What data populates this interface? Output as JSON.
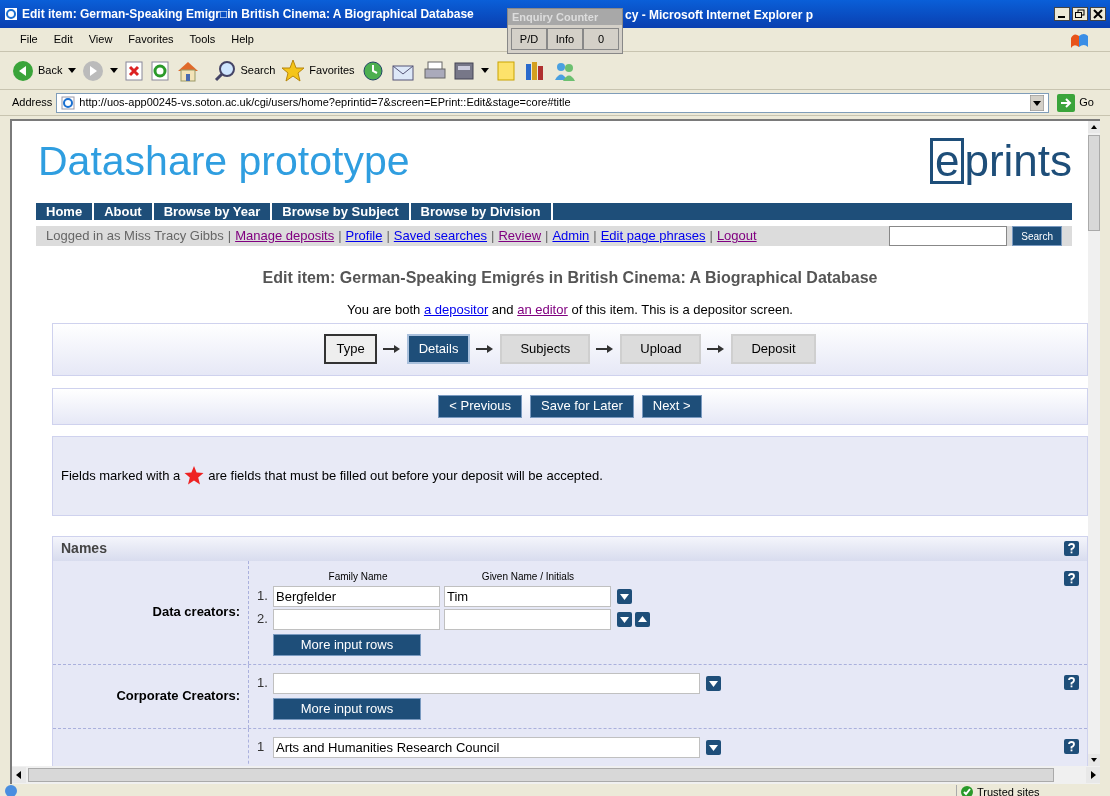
{
  "window": {
    "title_left": "Edit item: German-Speaking Emigr□in British Cinema: A Biographical Database",
    "title_right": "cy - Microsoft Internet Explorer p"
  },
  "enquiry_counter": {
    "title": "Enquiry Counter",
    "buttons": [
      "P/D",
      "Info",
      "0"
    ]
  },
  "menu": [
    "File",
    "Edit",
    "View",
    "Favorites",
    "Tools",
    "Help"
  ],
  "toolbar": {
    "back": "Back",
    "search": "Search",
    "favorites": "Favorites"
  },
  "address": {
    "label": "Address",
    "url": "http://uos-app00245-vs.soton.ac.uk/cgi/users/home?eprintid=7&screen=EPrint::Edit&stage=core#title",
    "go": "Go"
  },
  "site": {
    "title": "Datashare prototype",
    "logo_boxed": "e",
    "logo_rest": "prints"
  },
  "nav": [
    "Home",
    "About",
    "Browse by Year",
    "Browse by Subject",
    "Browse by Division"
  ],
  "user_bar": {
    "prefix": "Logged in as Miss Tracy Gibbs",
    "links": [
      {
        "separator": "|",
        "label": "Manage deposits",
        "visited": true
      },
      {
        "separator": "|",
        "label": "Profile",
        "visited": false
      },
      {
        "separator": "|",
        "label": "Saved searches",
        "visited": false
      },
      {
        "separator": "|",
        "label": "Review",
        "visited": true
      },
      {
        "separator": "|",
        "label": "Admin",
        "visited": false
      },
      {
        "separator": "|",
        "label": "Edit page phrases",
        "visited": false
      },
      {
        "separator": "|",
        "label": "Logout",
        "visited": true
      }
    ],
    "search_button": "Search"
  },
  "page_title": "Edit item: German-Speaking Emigrés in British Cinema: A Biographical Database",
  "intro": [
    {
      "kind": "text",
      "text": "You are both"
    },
    {
      "kind": "link",
      "text": "a depositor",
      "visited": false
    },
    {
      "kind": "text",
      "text": "and"
    },
    {
      "kind": "link",
      "text": "an editor",
      "visited": true
    },
    {
      "kind": "text",
      "text": "of this item. This is a depositor screen."
    }
  ],
  "steps": [
    {
      "label": "Type",
      "selected": false,
      "done": true
    },
    {
      "label": "Details",
      "selected": true,
      "done": false
    },
    {
      "label": "Subjects",
      "selected": false,
      "done": false
    },
    {
      "label": "Upload",
      "selected": false,
      "done": false
    },
    {
      "label": "Deposit",
      "selected": false,
      "done": false
    }
  ],
  "form_buttons": [
    "< Previous",
    "Save for Later",
    "Next >"
  ],
  "notice": {
    "before": "Fields marked with a",
    "after": "are fields that must be filled out before your deposit will be accepted."
  },
  "section": {
    "title": "Names",
    "fields": [
      {
        "kind": "names",
        "label": "Data creators:",
        "columns": [
          "Family Name",
          "Given Name / Initials"
        ],
        "rows": [
          {
            "number": "1.",
            "family": "Bergfelder",
            "given": "Tim",
            "can_move_up": false
          },
          {
            "number": "2.",
            "can_move_up": true
          }
        ],
        "more": "More input rows"
      },
      {
        "kind": "single",
        "label": "Corporate Creators:",
        "rows": [
          {
            "number": "1.",
            "can_move_up": false
          }
        ],
        "more": "More input rows"
      },
      {
        "kind": "single",
        "rows": [
          {
            "number": "1",
            "value": "Arts and Humanities Research Council",
            "can_move_up": false
          }
        ]
      }
    ]
  },
  "status_bar": {
    "zone": "Trusted sites"
  }
}
